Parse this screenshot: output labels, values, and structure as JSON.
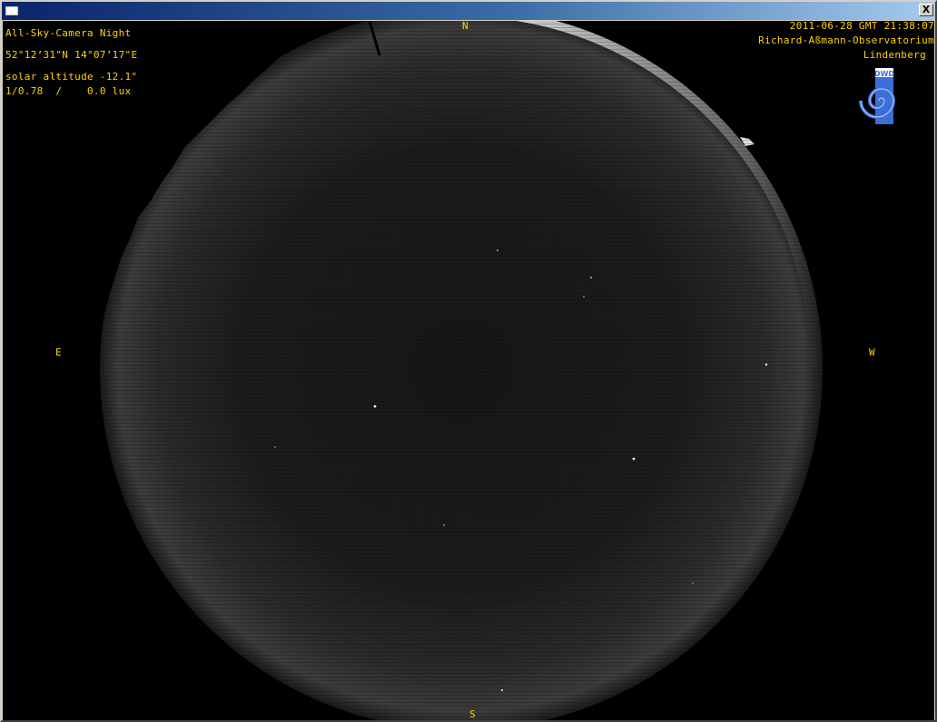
{
  "window": {
    "title": "",
    "close_label": "X"
  },
  "overlay": {
    "camera_title": "All-Sky-Camera Night",
    "coordinates": "52°12’31\"N 14°07’17\"E",
    "solar_altitude": "solar altitude -12.1°",
    "exposure": "1/0.78  /    0.0 lux",
    "datetime": "2011-06-28 GMT 21:38:07",
    "observatory": "Richard-Aßmann-Observatorium",
    "location": "Lindenberg",
    "logo_text": "DWD"
  },
  "compass": {
    "north": "N",
    "south": "S",
    "east": "E",
    "west": "W"
  },
  "colors": {
    "overlay_text": "#ffd200",
    "logo_blue": "#3a6fd8",
    "sky_background": "#000000"
  }
}
